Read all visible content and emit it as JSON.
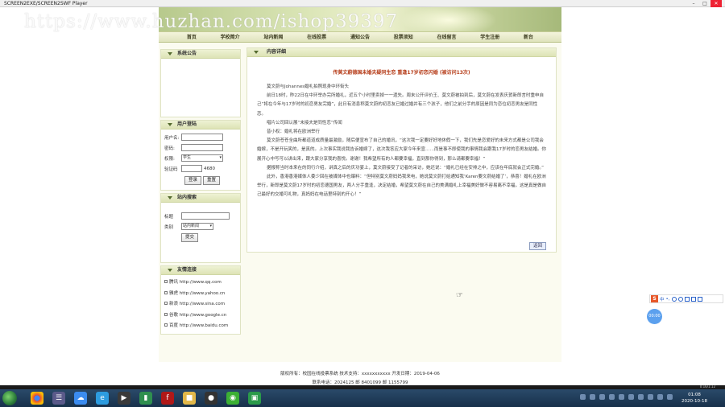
{
  "window": {
    "title": "SCREEN2EXE/SCREEN2SWF Player",
    "minimize": "–",
    "maximize": "□",
    "close": "✕"
  },
  "watermark": "https://www.huzhan.com/ishop39397",
  "nav": [
    "首页",
    "学校简介",
    "站内新闻",
    "在线投票",
    "通知公告",
    "投票须知",
    "在线留言",
    "学生注册",
    "新台"
  ],
  "sidebar": {
    "notice": {
      "title": "系统公告"
    },
    "login": {
      "title": "用户登陆",
      "username_label": "用户名:",
      "password_label": "密码:",
      "role_label": "权限:",
      "role_value": "学生",
      "captcha_label": "验证码",
      "captcha_value": "4680",
      "login_button": "登录",
      "reset_button": "重置"
    },
    "search": {
      "title": "站内搜索",
      "keyword_label": "标题",
      "type_label": "类别",
      "type_value": "站内新闻",
      "submit_button": "提交"
    },
    "links": {
      "title": "友情连接",
      "items": [
        "腾讯 http://www.qq.com",
        "雅虎 http://www.yahoo.cn",
        "新浪 http://www.sina.com",
        "谷歌 http://www.google.cn",
        "百度 http://www.baidu.com"
      ]
    }
  },
  "content": {
    "header": "内容详细",
    "article_title": "传莫文蔚德国未婚夫疑同生恋 重逢17岁初恋闪婚 (被访问13次)",
    "paragraphs": [
      "莫文蔚与Johannes婚礼拍照现身中环街头",
      "前日18时，昨22日在中环举办完所婚礼，近五个小时里卖掉一一遗失。周末公开评价王、莫文蔚被拍到后，莫文蔚在发表庆贺新郎言时重申自己“将在今年与17岁时的初恋男友完婚”，此日有消息称莫文蔚的初恋友已婚过婚并有三个孩子，他们之前分手的原因是同为恋位初恋男友是同性恋。",
      "唱片公司回认展“未接夫是同性恋”传闻",
      "昔小权：婚礼将在欧洲举行",
      "莫文蔚苍苍全曲所都道道成质量最激励，随后便宣布了自己的婚讯，“这次我一定要好好地休假一下，我们先是恋爱好的未来方式都是公司我会婚嫁，不是开玩笑的，是真的。上次事实我说我告诉婚嫁了，这次我答应大家今年来宣……而是事不即使我的事情我会跟我17岁时的恋男友结婚。你展开心中写可以讲出来，跟大家分享我的喜悦。谢谢！我希望所有的人都要幸福，直到那你得到，那么请都要幸福！”",
      "据报称当时本来在的同行介绍，讲真之后的庆功宴上，莫文蔚接受了记者的采访，她还说：“婚礼已经在安排之中，应该在年底就会正式完婚。”",
      "此外，香港香港媒体人委少回在被媒体中也爆料：“但特别莫文蔚妈妈我来电，她说莫文蔚打给通知我‘Karen要文蔚结婚了’，恭喜！婚礼在欧洲举行，新郎是莫文蔚17岁时的初恋德国男友，两人分手重逢，决定结婚，希望莫文蔚在自己的美满婚礼上幸福美好做不容易离不幸福，这是真是做自己最好的交婚可礼物，真妈妈在电话里特别的开心！”"
    ],
    "back_button": "返回"
  },
  "footer": {
    "line1": "版权所有：校园在线投票系统 技术支持：xxxxxxxxxxx 开发日期：2019-04-06",
    "line2": "联系电话：2024125 邮 8401099 邮 1155799"
  },
  "ime": {
    "lang": "中",
    "punct": "•,"
  },
  "bubble": "00:00",
  "taskbar": {
    "clock_time": "01:08",
    "clock_date": "2020-10-18",
    "player_time": "0:16/1:12"
  }
}
